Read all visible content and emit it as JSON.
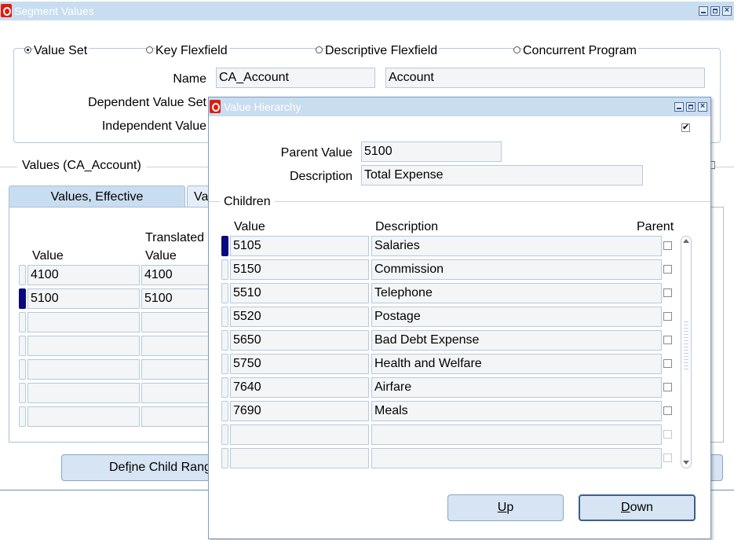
{
  "main_window": {
    "title": "Segment Values",
    "radios": [
      {
        "label": "Value Set",
        "selected": true
      },
      {
        "label": "Key Flexfield",
        "selected": false
      },
      {
        "label": "Descriptive Flexfield",
        "selected": false
      },
      {
        "label": "Concurrent Program",
        "selected": false
      }
    ],
    "name_label": "Name",
    "name_value": "CA_Account",
    "name_desc": "Account",
    "dependent_label": "Dependent Value Set",
    "independent_label": "Independent Value",
    "values_heading": "Values (CA_Account)",
    "tabs": [
      "Values, Effective",
      "Va"
    ],
    "table_headers": {
      "value": "Value",
      "translated_line1": "Translated",
      "translated_line2": "Value"
    },
    "rows": [
      {
        "value": "4100",
        "translated": "4100"
      },
      {
        "value": "5100",
        "translated": "5100"
      },
      {
        "value": "",
        "translated": ""
      },
      {
        "value": "",
        "translated": ""
      },
      {
        "value": "",
        "translated": ""
      },
      {
        "value": "",
        "translated": ""
      },
      {
        "value": "",
        "translated": ""
      }
    ],
    "define_child_btn_pre": "Def",
    "define_child_btn_accel": "i",
    "define_child_btn_post": "ne Child Rang"
  },
  "dialog": {
    "title": "Value Hierarchy",
    "parent_value_label": "Parent Value",
    "parent_value": "5100",
    "description_label": "Description",
    "description": "Total Expense",
    "children_label": "Children",
    "col_value": "Value",
    "col_description": "Description",
    "col_parent": "Parent",
    "children": [
      {
        "value": "5105",
        "description": "Salaries"
      },
      {
        "value": "5150",
        "description": "Commission"
      },
      {
        "value": "5510",
        "description": "Telephone"
      },
      {
        "value": "5520",
        "description": "Postage"
      },
      {
        "value": "5650",
        "description": "Bad Debt Expense"
      },
      {
        "value": "5750",
        "description": "Health and Welfare"
      },
      {
        "value": "7640",
        "description": "Airfare"
      },
      {
        "value": "7690",
        "description": "Meals"
      },
      {
        "value": "",
        "description": ""
      },
      {
        "value": "",
        "description": ""
      }
    ],
    "up_accel": "U",
    "up_rest": "p",
    "down_accel": "D",
    "down_rest": "own"
  }
}
